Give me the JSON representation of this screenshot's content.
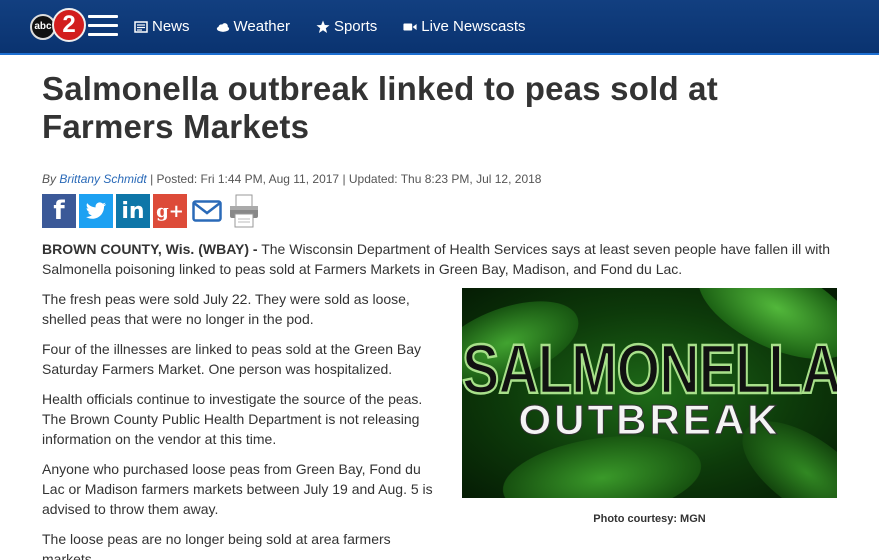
{
  "header": {
    "logo_small": "abc",
    "logo_number": "2",
    "nav": [
      {
        "label": "News",
        "icon": "newspaper-icon"
      },
      {
        "label": "Weather",
        "icon": "cloud-icon"
      },
      {
        "label": "Sports",
        "icon": "star-icon"
      },
      {
        "label": "Live Newscasts",
        "icon": "video-camera-icon"
      }
    ]
  },
  "article": {
    "title": "Salmonella outbreak linked to peas sold at Farmers Markets",
    "byline": {
      "by": "By",
      "author": "Brittany Schmidt",
      "posted": "| Posted: Fri 1:44 PM, Aug 11, 2017",
      "updated": "| Updated: Thu 8:23 PM, Jul 12, 2018"
    },
    "share": [
      "facebook",
      "twitter",
      "linkedin",
      "google-plus",
      "email",
      "print"
    ],
    "dateline": "BROWN COUNTY, Wis. (WBAY) -",
    "lede": " The Wisconsin Department of Health Services says at least seven people have fallen ill with Salmonella poisoning linked to peas sold at Farmers Markets in Green Bay, Madison, and Fond du Lac.",
    "paragraphs": [
      "The fresh peas were sold July 22. They were sold as loose, shelled peas that were no longer in the pod.",
      "Four of the illnesses are linked to peas sold at the Green Bay Saturday Farmers Market. One person was hospitalized.",
      "Health officials continue to investigate the source of the peas. The Brown County Public Health Department is not releasing information on the vendor at this time.",
      "Anyone who purchased loose peas from Green Bay, Fond du Lac or Madison farmers markets between July 19 and Aug. 5 is advised to throw them away.",
      "The loose peas are no longer being sold at area farmers markets."
    ],
    "photo": {
      "line1": "SALMONELLA",
      "line2": "OUTBREAK",
      "caption": "Photo courtesy: MGN"
    }
  },
  "colors": {
    "header_bg": "#0d3b7a",
    "header_border": "#1d6fd1",
    "link": "#2a6ab8",
    "facebook": "#3b5998",
    "twitter": "#1da1f2",
    "linkedin": "#0e76a8",
    "google_plus": "#dd4b39"
  }
}
